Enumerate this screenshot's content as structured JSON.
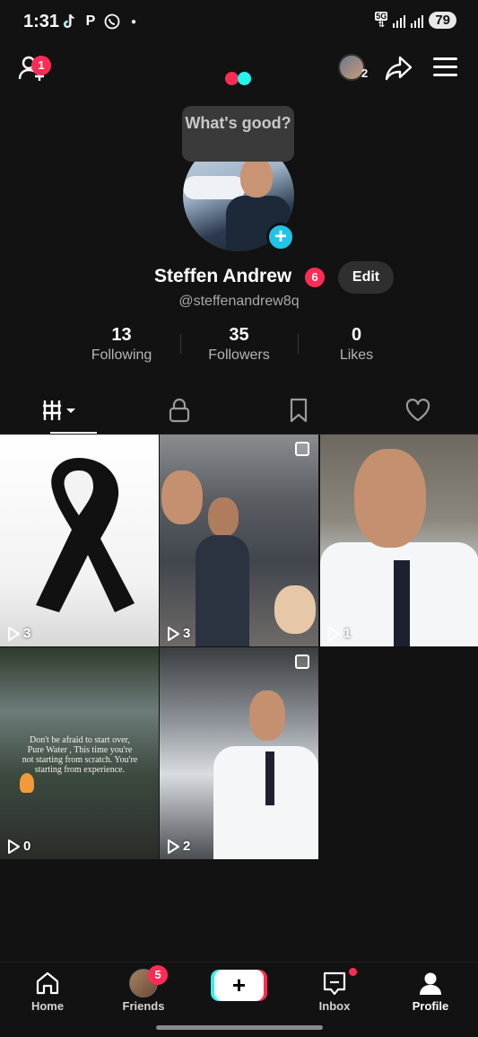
{
  "status_bar": {
    "time": "1:31",
    "network": "5G",
    "battery": "79",
    "app_icons": [
      "tiktok-icon",
      "p-icon",
      "whatsapp-icon"
    ]
  },
  "top_nav": {
    "add_friend_badge": "1",
    "account_count": "2"
  },
  "profile": {
    "bubble_text": "What's good?",
    "display_name": "Steffen Andrew",
    "name_badge": "6",
    "edit_label": "Edit",
    "handle": "@steffenandrew8q"
  },
  "stats": [
    {
      "value": "13",
      "label": "Following"
    },
    {
      "value": "35",
      "label": "Followers"
    },
    {
      "value": "0",
      "label": "Likes"
    }
  ],
  "tabs": [
    "videos-grid-icon",
    "lock-icon",
    "bookmark-icon",
    "heart-icon"
  ],
  "videos": [
    {
      "views": "3"
    },
    {
      "views": "3"
    },
    {
      "views": "1"
    },
    {
      "views": "0",
      "caption": "Don't be afraid to start over, Pure Water , This time you're not starting from scratch. You're starting from experience."
    },
    {
      "views": "2"
    }
  ],
  "bottom_nav": {
    "home": "Home",
    "friends": "Friends",
    "friends_badge": "5",
    "inbox": "Inbox",
    "profile": "Profile"
  },
  "colors": {
    "accent_red": "#fe2c55",
    "accent_cyan": "#25f4ee",
    "background": "#121212"
  }
}
